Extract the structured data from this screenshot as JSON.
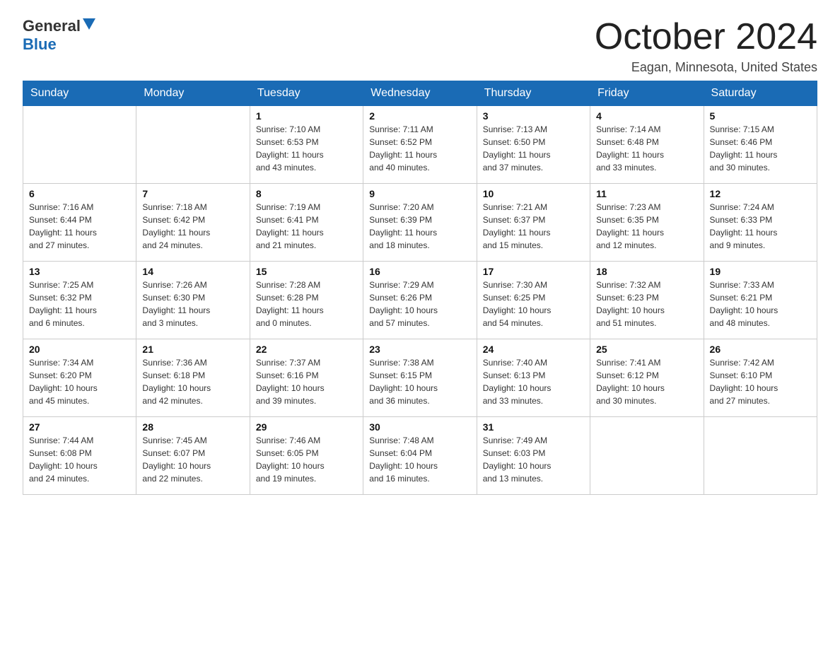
{
  "logo": {
    "general": "General",
    "triangle": "▲",
    "blue": "Blue"
  },
  "header": {
    "title": "October 2024",
    "subtitle": "Eagan, Minnesota, United States"
  },
  "weekdays": [
    "Sunday",
    "Monday",
    "Tuesday",
    "Wednesday",
    "Thursday",
    "Friday",
    "Saturday"
  ],
  "weeks": [
    [
      {
        "day": "",
        "info": ""
      },
      {
        "day": "",
        "info": ""
      },
      {
        "day": "1",
        "info": "Sunrise: 7:10 AM\nSunset: 6:53 PM\nDaylight: 11 hours\nand 43 minutes."
      },
      {
        "day": "2",
        "info": "Sunrise: 7:11 AM\nSunset: 6:52 PM\nDaylight: 11 hours\nand 40 minutes."
      },
      {
        "day": "3",
        "info": "Sunrise: 7:13 AM\nSunset: 6:50 PM\nDaylight: 11 hours\nand 37 minutes."
      },
      {
        "day": "4",
        "info": "Sunrise: 7:14 AM\nSunset: 6:48 PM\nDaylight: 11 hours\nand 33 minutes."
      },
      {
        "day": "5",
        "info": "Sunrise: 7:15 AM\nSunset: 6:46 PM\nDaylight: 11 hours\nand 30 minutes."
      }
    ],
    [
      {
        "day": "6",
        "info": "Sunrise: 7:16 AM\nSunset: 6:44 PM\nDaylight: 11 hours\nand 27 minutes."
      },
      {
        "day": "7",
        "info": "Sunrise: 7:18 AM\nSunset: 6:42 PM\nDaylight: 11 hours\nand 24 minutes."
      },
      {
        "day": "8",
        "info": "Sunrise: 7:19 AM\nSunset: 6:41 PM\nDaylight: 11 hours\nand 21 minutes."
      },
      {
        "day": "9",
        "info": "Sunrise: 7:20 AM\nSunset: 6:39 PM\nDaylight: 11 hours\nand 18 minutes."
      },
      {
        "day": "10",
        "info": "Sunrise: 7:21 AM\nSunset: 6:37 PM\nDaylight: 11 hours\nand 15 minutes."
      },
      {
        "day": "11",
        "info": "Sunrise: 7:23 AM\nSunset: 6:35 PM\nDaylight: 11 hours\nand 12 minutes."
      },
      {
        "day": "12",
        "info": "Sunrise: 7:24 AM\nSunset: 6:33 PM\nDaylight: 11 hours\nand 9 minutes."
      }
    ],
    [
      {
        "day": "13",
        "info": "Sunrise: 7:25 AM\nSunset: 6:32 PM\nDaylight: 11 hours\nand 6 minutes."
      },
      {
        "day": "14",
        "info": "Sunrise: 7:26 AM\nSunset: 6:30 PM\nDaylight: 11 hours\nand 3 minutes."
      },
      {
        "day": "15",
        "info": "Sunrise: 7:28 AM\nSunset: 6:28 PM\nDaylight: 11 hours\nand 0 minutes."
      },
      {
        "day": "16",
        "info": "Sunrise: 7:29 AM\nSunset: 6:26 PM\nDaylight: 10 hours\nand 57 minutes."
      },
      {
        "day": "17",
        "info": "Sunrise: 7:30 AM\nSunset: 6:25 PM\nDaylight: 10 hours\nand 54 minutes."
      },
      {
        "day": "18",
        "info": "Sunrise: 7:32 AM\nSunset: 6:23 PM\nDaylight: 10 hours\nand 51 minutes."
      },
      {
        "day": "19",
        "info": "Sunrise: 7:33 AM\nSunset: 6:21 PM\nDaylight: 10 hours\nand 48 minutes."
      }
    ],
    [
      {
        "day": "20",
        "info": "Sunrise: 7:34 AM\nSunset: 6:20 PM\nDaylight: 10 hours\nand 45 minutes."
      },
      {
        "day": "21",
        "info": "Sunrise: 7:36 AM\nSunset: 6:18 PM\nDaylight: 10 hours\nand 42 minutes."
      },
      {
        "day": "22",
        "info": "Sunrise: 7:37 AM\nSunset: 6:16 PM\nDaylight: 10 hours\nand 39 minutes."
      },
      {
        "day": "23",
        "info": "Sunrise: 7:38 AM\nSunset: 6:15 PM\nDaylight: 10 hours\nand 36 minutes."
      },
      {
        "day": "24",
        "info": "Sunrise: 7:40 AM\nSunset: 6:13 PM\nDaylight: 10 hours\nand 33 minutes."
      },
      {
        "day": "25",
        "info": "Sunrise: 7:41 AM\nSunset: 6:12 PM\nDaylight: 10 hours\nand 30 minutes."
      },
      {
        "day": "26",
        "info": "Sunrise: 7:42 AM\nSunset: 6:10 PM\nDaylight: 10 hours\nand 27 minutes."
      }
    ],
    [
      {
        "day": "27",
        "info": "Sunrise: 7:44 AM\nSunset: 6:08 PM\nDaylight: 10 hours\nand 24 minutes."
      },
      {
        "day": "28",
        "info": "Sunrise: 7:45 AM\nSunset: 6:07 PM\nDaylight: 10 hours\nand 22 minutes."
      },
      {
        "day": "29",
        "info": "Sunrise: 7:46 AM\nSunset: 6:05 PM\nDaylight: 10 hours\nand 19 minutes."
      },
      {
        "day": "30",
        "info": "Sunrise: 7:48 AM\nSunset: 6:04 PM\nDaylight: 10 hours\nand 16 minutes."
      },
      {
        "day": "31",
        "info": "Sunrise: 7:49 AM\nSunset: 6:03 PM\nDaylight: 10 hours\nand 13 minutes."
      },
      {
        "day": "",
        "info": ""
      },
      {
        "day": "",
        "info": ""
      }
    ]
  ]
}
